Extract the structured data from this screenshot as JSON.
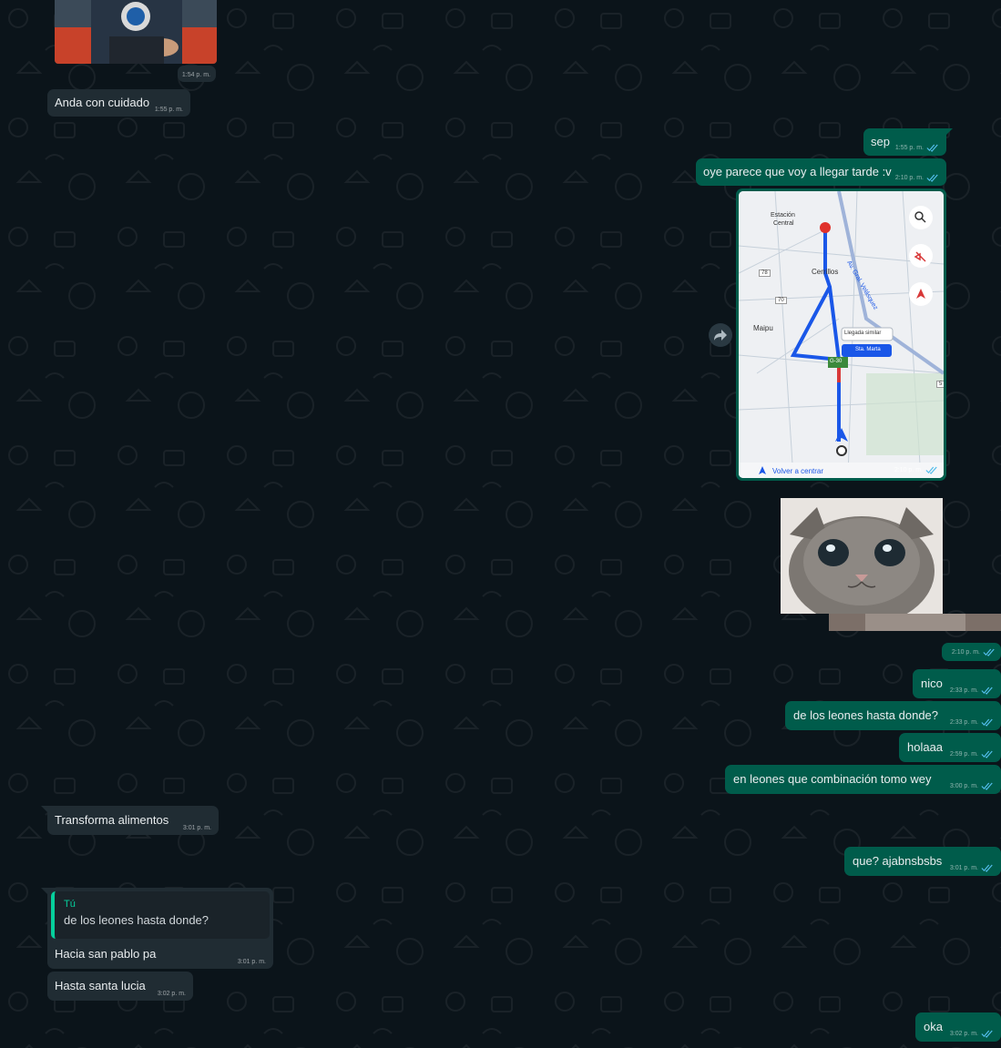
{
  "theme": {
    "incoming": "#202c33",
    "outgoing": "#005c4b",
    "background": "#0b141a",
    "tick": "#53bdeb",
    "quote_bar": "#06cf9c"
  },
  "messages": {
    "m0_time": "1:54 p. m.",
    "m1": {
      "text": "Anda con cuidado",
      "time": "1:55 p. m."
    },
    "m2": {
      "text": "sep",
      "time": "1:55 p. m."
    },
    "m3": {
      "text": "oye parece que voy a llegar tarde :v",
      "time": "2:10 p. m."
    },
    "map": {
      "time": "2:10 p. m.",
      "labels": {
        "station": "Estación",
        "station2": "Central",
        "cerrillos": "Cerrillos",
        "maipu": "Maipu",
        "llegada": "Llegada similar",
        "sta_marta": "Sta. Marta",
        "route": "G-30",
        "road78": "78",
        "road70": "70",
        "road5": "5",
        "avenue": "Av. Gral. Velásquez",
        "recenter": "Volver a centrar"
      },
      "icons": [
        "search-icon",
        "mute-icon",
        "compass-icon",
        "forward-icon",
        "navigation-arrow-icon",
        "destination-pin-icon"
      ]
    },
    "cat_time": "2:10 p. m.",
    "m4": {
      "text": "nico",
      "time": "2:33 p. m."
    },
    "m5": {
      "text": "de los leones hasta donde?",
      "time": "2:33 p. m."
    },
    "m6": {
      "text": "holaaa",
      "time": "2:59 p. m."
    },
    "m7": {
      "text": "en leones que combinación tomo wey",
      "time": "3:00 p. m."
    },
    "m8": {
      "text": "Transforma alimentos",
      "time": "3:01 p. m."
    },
    "m9": {
      "text": "que? ajabnsbsbs",
      "time": "3:01 p. m."
    },
    "m10": {
      "quote_author": "Tú",
      "quote_text": "de los leones hasta donde?",
      "text": "Hacia san pablo pa",
      "time": "3:01 p. m."
    },
    "m11": {
      "text": "Hasta santa lucia",
      "time": "3:02 p. m."
    },
    "m12": {
      "text": "oka",
      "time": "3:02 p. m."
    }
  }
}
